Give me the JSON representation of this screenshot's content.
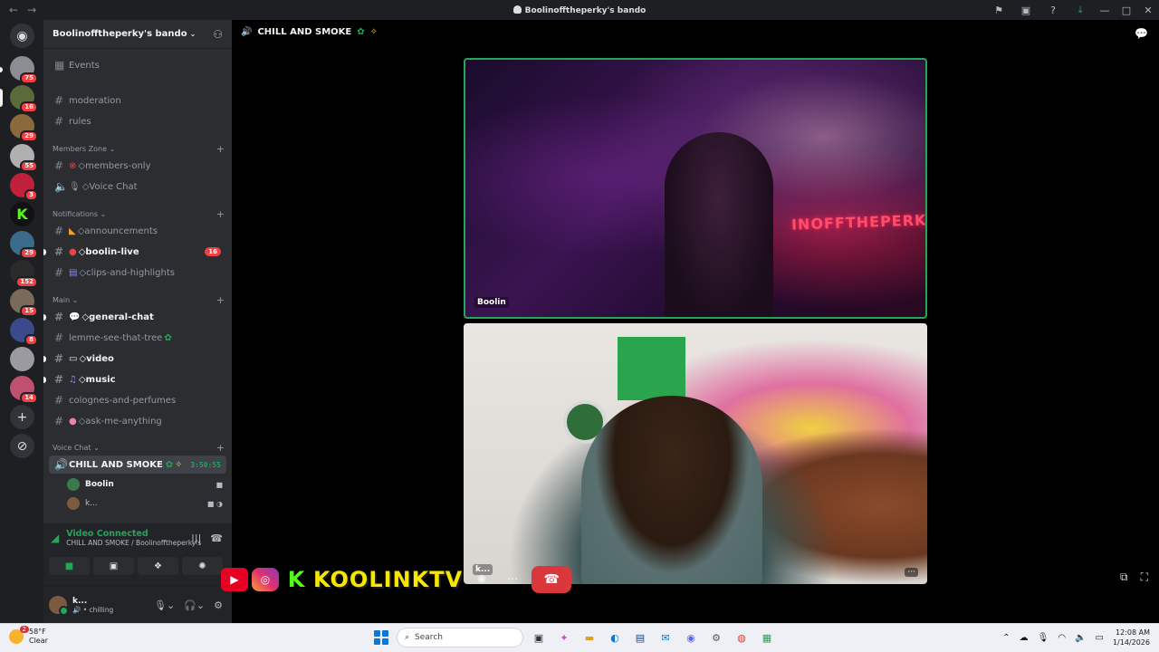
{
  "window": {
    "title": "Boolinofftheperky's bando"
  },
  "server_rail": {
    "badges": [
      "75",
      "16",
      "29",
      "55",
      "3",
      "29",
      "152",
      "15",
      "8",
      "14"
    ]
  },
  "guild": {
    "name": "Boolinofftheperky's bando",
    "events_label": "Events"
  },
  "channels": {
    "moderation": "moderation",
    "rules": "rules",
    "members_zone": "Members Zone",
    "members_only": "◇members-only",
    "voice_chat": "◇Voice Chat",
    "notifications": "Notifications",
    "announcements": "◇announcements",
    "boolin_live": "◇boolin-live",
    "boolin_live_mentions": "16",
    "clips": "◇clips-and-highlights",
    "main": "Main",
    "general_chat": "◇general-chat",
    "lemme": "lemme-see-that-tree",
    "video": "◇video",
    "music": "◇music",
    "colognes": "colognes-and-perfumes",
    "ask": "◇ask-me-anything",
    "voice_cat": "Voice Chat",
    "voice_channel": "CHILL AND SMOKE",
    "voice_timer": "3:50:55"
  },
  "voice_users": [
    {
      "name": "Boolin"
    },
    {
      "name": "k..."
    }
  ],
  "rtc": {
    "status": "Video Connected",
    "sub": "CHILL AND SMOKE / Boolinofftheperky's bando"
  },
  "user": {
    "name": "k...",
    "status": "chilling"
  },
  "stage": {
    "channel_title": "CHILL AND SMOKE",
    "tile1_name": "Boolin",
    "tile1_neon": "INOFFTHEPERK",
    "tile2_name": "k...",
    "more": "···"
  },
  "overlay": {
    "brand": "KOOLINKTV",
    "kick_letter": "K"
  },
  "taskbar": {
    "weather_temp": "58°F",
    "weather_desc": "Clear",
    "weather_badge": "2",
    "search_placeholder": "Search",
    "time": "12:08 AM",
    "date": "1/14/2026"
  },
  "colors": {
    "accent_green": "#23a55a",
    "mention_red": "#f23f43",
    "hangup_red": "#da373c",
    "brand_yellow": "#f7e600"
  }
}
